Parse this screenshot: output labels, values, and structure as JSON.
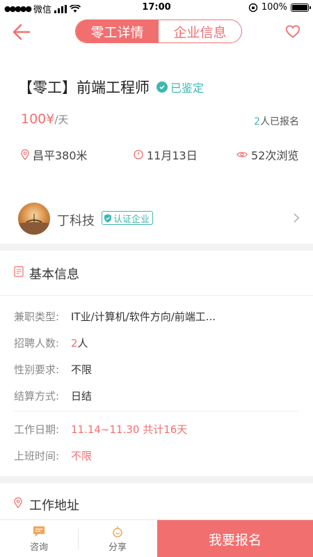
{
  "status_bar": {
    "carrier": "微信",
    "time": "17:00",
    "battery": "100%"
  },
  "nav": {
    "tabs": [
      {
        "label": "零工详情",
        "active": true
      },
      {
        "label": "企业信息",
        "active": false
      }
    ]
  },
  "job": {
    "title": "【零工】前端工程师",
    "verified_label": "已鉴定",
    "price": "100¥",
    "price_unit": "/天",
    "signed_count": "2",
    "signed_suffix": "人已报名",
    "location": "昌平380米",
    "date": "11月13日",
    "views": "52次浏览"
  },
  "company": {
    "name": "丁科技",
    "cert_label": "认证企业"
  },
  "basic_info": {
    "heading": "基本信息",
    "rows": [
      {
        "key": "兼职类型:",
        "value": "IT业/计算机/软件方向/前端工..."
      },
      {
        "key": "招聘人数:",
        "value_num": "2",
        "value_suffix": "人"
      },
      {
        "key": "性别要求:",
        "value": "不限"
      },
      {
        "key": "结算方式:",
        "value": "日结"
      },
      {
        "key": "工作日期:",
        "value": "11.14~11.30 共计16天"
      },
      {
        "key": "上班时间:",
        "value": "不限"
      }
    ]
  },
  "work_address": {
    "heading": "工作地址"
  },
  "bottom_bar": {
    "consult": "咨询",
    "share": "分享",
    "apply": "我要报名"
  },
  "colors": {
    "accent": "#f26f6f",
    "verified": "#3cb7b1"
  }
}
